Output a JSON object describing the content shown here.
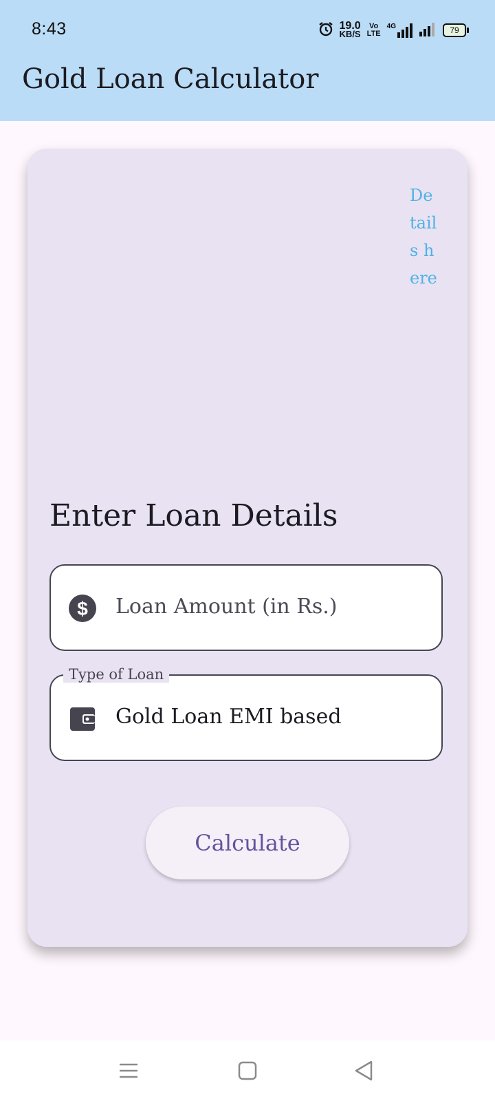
{
  "status_bar": {
    "time": "8:43",
    "net_speed_value": "19.0",
    "net_speed_unit": "KB/S",
    "volte": "Vo LTE",
    "network_type": "4G",
    "battery": "79"
  },
  "app_bar": {
    "title": "Gold Loan Calculator"
  },
  "card": {
    "details_text": "Details here",
    "section_title": "Enter Loan Details",
    "amount_field": {
      "placeholder": "Loan Amount (in Rs.)",
      "icon": "dollar-circle-icon"
    },
    "type_field": {
      "label": "Type of Loan",
      "value": "Gold Loan EMI based",
      "icon": "wallet-icon"
    },
    "calculate_label": "Calculate"
  },
  "colors": {
    "app_bar": "#bbdcf7",
    "card": "#e9e2f2",
    "details_link": "#4eb2e7",
    "button_text": "#63529d"
  },
  "nav_bar": {
    "icons": [
      "menu-icon",
      "home-square-icon",
      "back-triangle-icon"
    ]
  }
}
